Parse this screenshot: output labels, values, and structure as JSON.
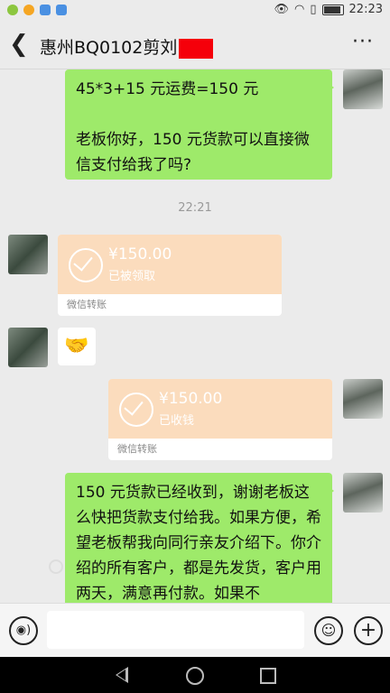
{
  "status_bar": {
    "time": "22:23"
  },
  "header": {
    "back_glyph": "❮",
    "title": "惠州BQ0102剪刘",
    "more_glyph": "···"
  },
  "messages": {
    "m1": "45*3+15 元运费=150 元\n\n老板你好，150 元货款可以直接微信支付给我了吗?",
    "time1": "22:21",
    "transfer1": {
      "amount": "¥150.00",
      "status": "已被领取",
      "footer": "微信转账"
    },
    "emoji": "🤝",
    "transfer2": {
      "amount": "¥150.00",
      "status": "已收钱",
      "footer": "微信转账"
    },
    "m2": "150 元货款已经收到，谢谢老板这么快把货款支付给我。如果方便，希望老板帮我向同行亲友介绍下。你介绍的所有客户，都是先发货，客户用两天，满意再付款。如果不"
  },
  "input_bar": {
    "voice_glyph": "◉)",
    "smile_glyph": "☺",
    "plus_glyph": "+"
  }
}
